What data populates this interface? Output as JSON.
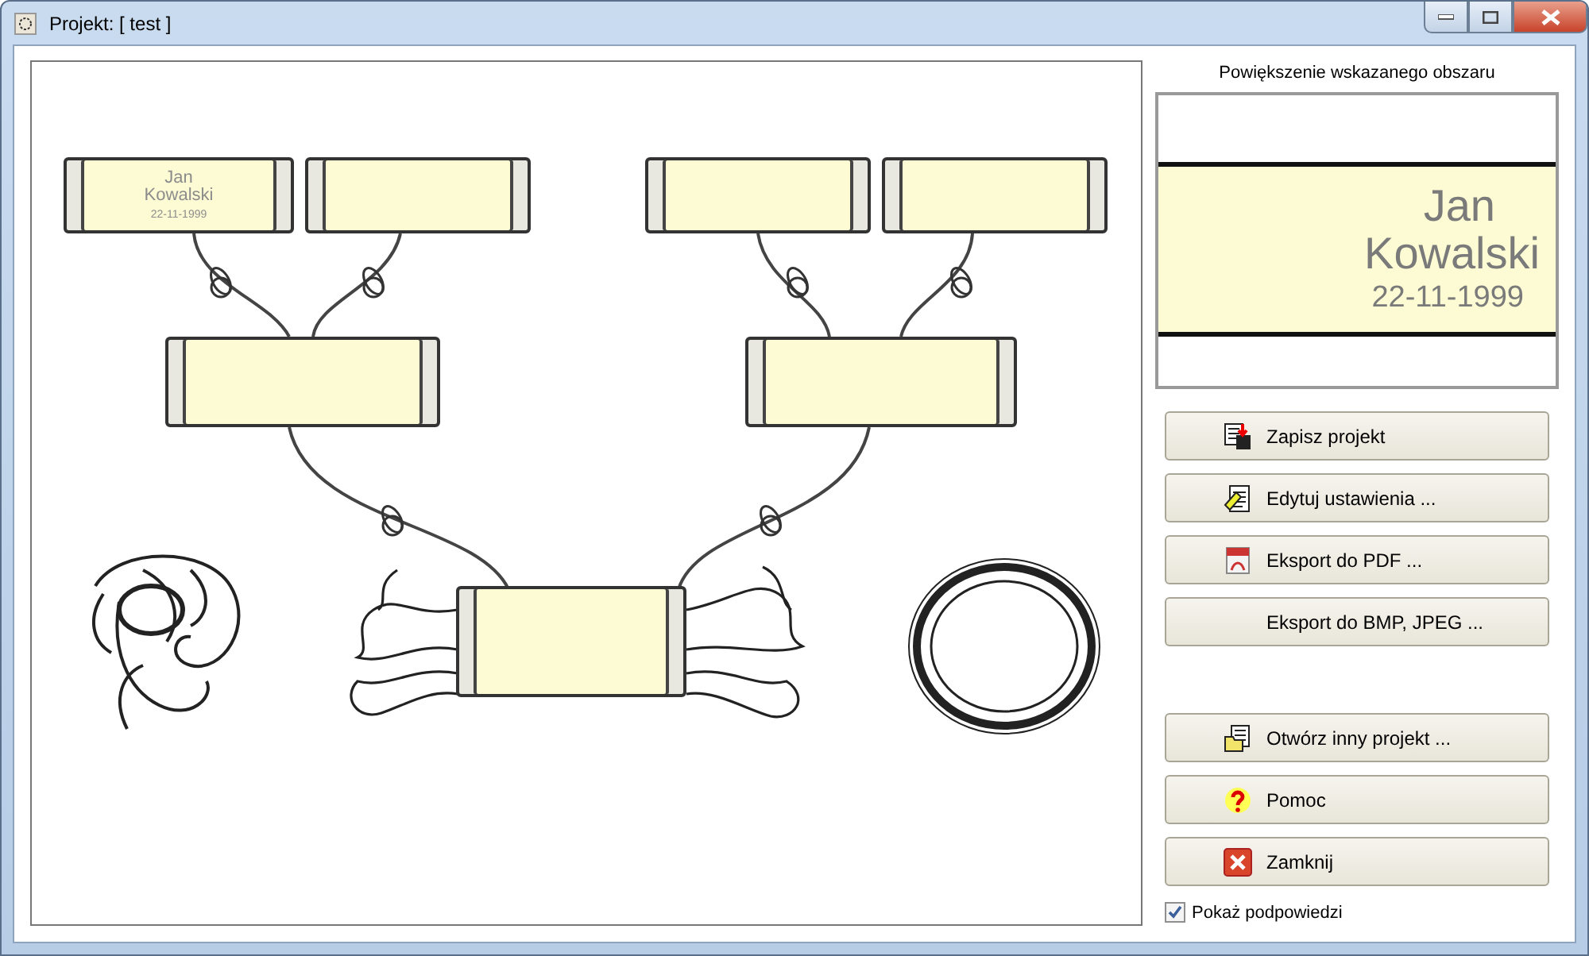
{
  "window": {
    "title": "Projekt: [ test ]"
  },
  "tree": {
    "scrolls": [
      {
        "kind": "filled",
        "lines": [
          "Jan",
          "Kowalski",
          "22-11-1999"
        ]
      },
      {
        "kind": "blank"
      },
      {
        "kind": "blank"
      },
      {
        "kind": "blank"
      },
      {
        "kind": "blank"
      },
      {
        "kind": "blank"
      },
      {
        "kind": "blank"
      }
    ]
  },
  "preview": {
    "title": "Powiększenie wskazanego obszaru",
    "lines": [
      "Jan",
      "Kowalski",
      "22-11-1999"
    ]
  },
  "buttons_top": [
    {
      "label": "Zapisz projekt",
      "kind": "save"
    },
    {
      "label": "Edytuj ustawienia  ...",
      "kind": "edit"
    },
    {
      "label": "Eksport do PDF ...",
      "kind": "pdf"
    },
    {
      "label": "Eksport do BMP, JPEG ...",
      "kind": "plain"
    }
  ],
  "buttons_bottom": [
    {
      "label": "Otwórz inny projekt ...",
      "kind": "open"
    },
    {
      "label": "Pomoc",
      "kind": "help"
    },
    {
      "label": "Zamknij",
      "kind": "close"
    }
  ],
  "show_tips": {
    "label": "Pokaż podpowiedzi",
    "checked": true
  }
}
